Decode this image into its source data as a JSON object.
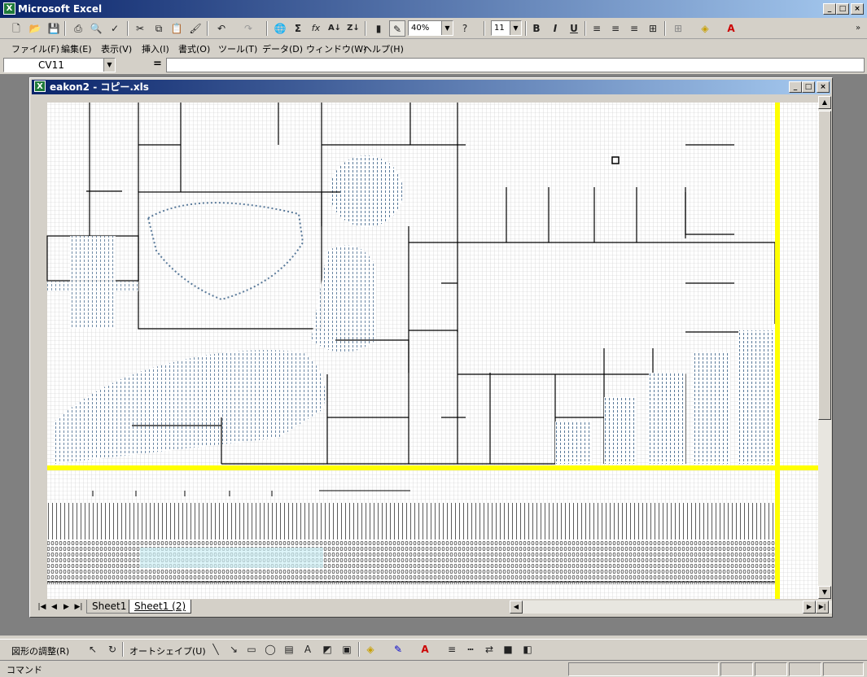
{
  "app": {
    "title": "Microsoft Excel"
  },
  "toolbar": {
    "zoom": "40%",
    "font_size": "11",
    "bold": "B",
    "italic": "I",
    "underline": "U",
    "sum": "Σ",
    "fx": "fx"
  },
  "menu": {
    "items": [
      "ファイル(F)",
      "編集(E)",
      "表示(V)",
      "挿入(I)",
      "書式(O)",
      "ツール(T)",
      "データ(D)",
      "ウィンドウ(W)",
      "ヘルプ(H)"
    ]
  },
  "formula": {
    "name_box": "CV11",
    "equals": "="
  },
  "document": {
    "title": "eakon2 - コピー.xls"
  },
  "sheets": {
    "tabs": [
      "Sheet1",
      "Sheet1 (2)"
    ],
    "active": "Sheet1 (2)"
  },
  "drawing": {
    "adjust": "図形の調整(R)",
    "autoshape": "オートシェイプ(U)"
  },
  "status": {
    "text": "コマンド"
  },
  "colors": {
    "highlight": "#ffff00",
    "accent": "#0a246a"
  }
}
